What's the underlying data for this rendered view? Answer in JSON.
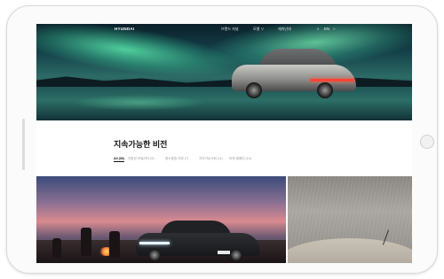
{
  "header": {
    "logo": "HYUNDAI",
    "nav": [
      "브랜드 저널",
      "모델 ∨",
      "재미난대"
    ],
    "icons": [
      "search-icon",
      "language-label",
      "menu-icon"
    ],
    "language_label": "EN"
  },
  "main": {
    "title": "지속가능한 비전",
    "tabs": [
      "All (36)",
      "전환된 모빌리티 (9)",
      "청소중립 여정 (7)",
      "지속가능사회 (11)",
      "미래 캠페인 (14)"
    ],
    "active_tab_index": 0
  },
  "hero": {
    "image_alt": "car under aurora by lake"
  },
  "tiles": [
    "people around fire with dark car",
    "wet road with car hood"
  ],
  "colors": {
    "accent": "#111111",
    "muted": "#9a9a9a",
    "frame": "#d9d9d9"
  }
}
